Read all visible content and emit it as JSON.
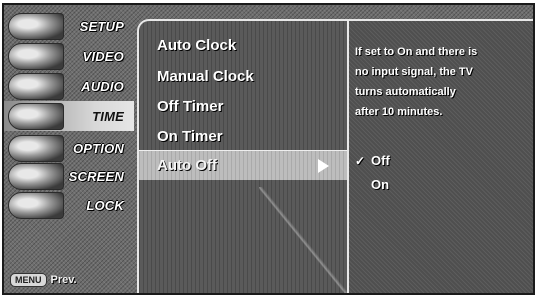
{
  "sidebar": {
    "items": [
      {
        "label": "SETUP",
        "icon": "setup-icon"
      },
      {
        "label": "VIDEO",
        "icon": "video-icon"
      },
      {
        "label": "AUDIO",
        "icon": "audio-icon"
      },
      {
        "label": "TIME",
        "icon": "time-icon"
      },
      {
        "label": "OPTION",
        "icon": "option-icon"
      },
      {
        "label": "SCREEN",
        "icon": "screen-icon"
      },
      {
        "label": "LOCK",
        "icon": "lock-icon"
      }
    ],
    "prev_key": "MENU",
    "prev_label": "Prev."
  },
  "submenu": {
    "items": [
      {
        "label": "Auto Clock"
      },
      {
        "label": "Manual Clock"
      },
      {
        "label": "Off Timer"
      },
      {
        "label": "On Timer"
      },
      {
        "label": "Auto Off"
      }
    ],
    "selected": "Auto Off"
  },
  "help": {
    "line1": "If set to On and there is",
    "line2": "no input signal, the TV",
    "line3": "turns automatically",
    "line4": "after 10 minutes."
  },
  "options": {
    "items": [
      {
        "label": "Off",
        "checked": "✓"
      },
      {
        "label": "On",
        "checked": ""
      }
    ]
  }
}
